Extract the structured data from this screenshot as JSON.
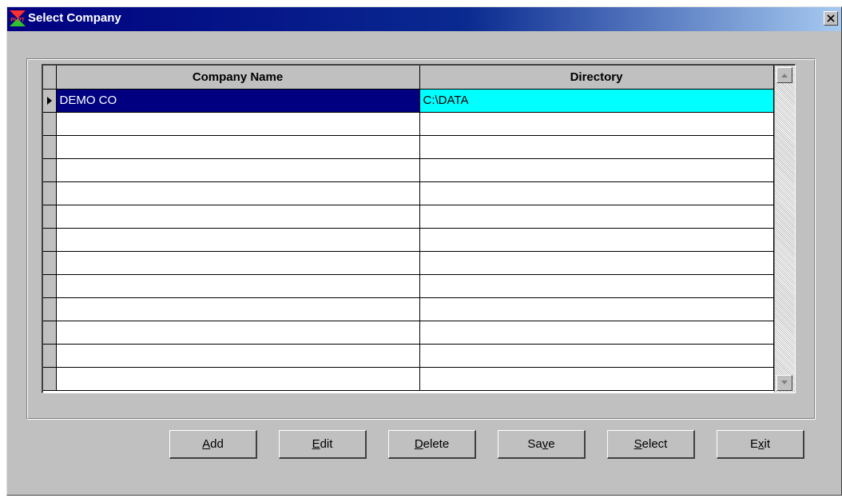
{
  "window": {
    "title": "Select Company",
    "app_icon_text": "PI PT"
  },
  "grid": {
    "columns": [
      "Company Name",
      "Directory"
    ],
    "rows": [
      {
        "name": "DEMO CO",
        "directory": "C:\\DATA",
        "selected": true
      }
    ],
    "empty_row_count": 12
  },
  "buttons": [
    {
      "label_pre": "",
      "label_key": "A",
      "label_post": "dd"
    },
    {
      "label_pre": "",
      "label_key": "E",
      "label_post": "dit"
    },
    {
      "label_pre": "",
      "label_key": "D",
      "label_post": "elete"
    },
    {
      "label_pre": "Sa",
      "label_key": "v",
      "label_post": "e"
    },
    {
      "label_pre": "",
      "label_key": "S",
      "label_post": "elect"
    },
    {
      "label_pre": "E",
      "label_key": "x",
      "label_post": "it"
    }
  ],
  "colors": {
    "title_bar": "#000080",
    "selected_name_bg": "#000080",
    "selected_dir_bg": "#00ffff",
    "face": "#c0c0c0"
  }
}
